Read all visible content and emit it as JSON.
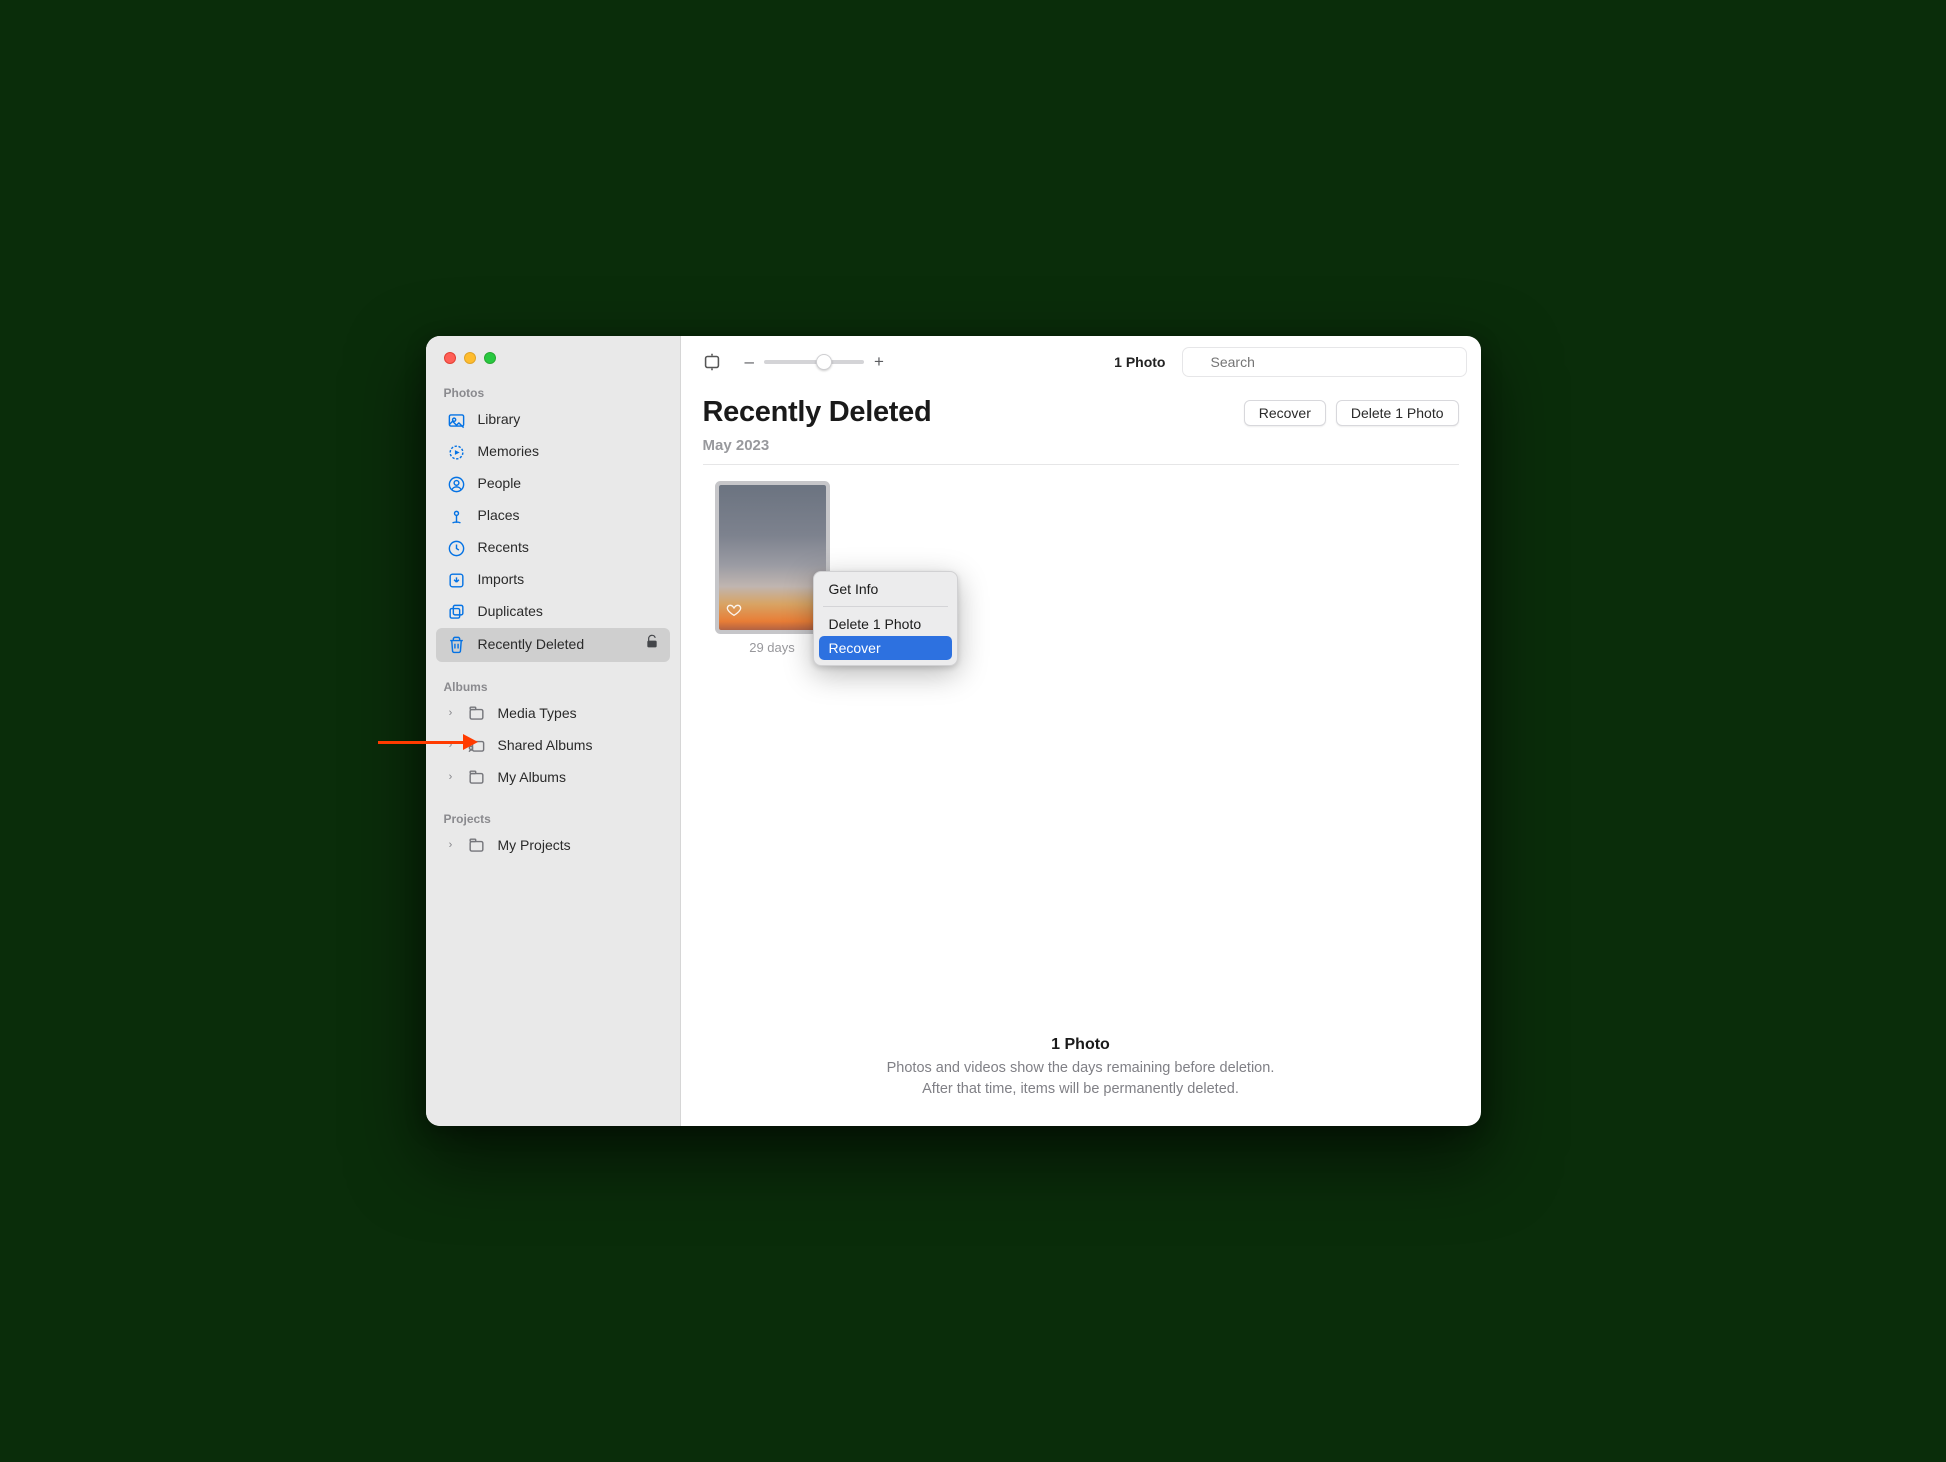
{
  "colors": {
    "accent": "#0472e4",
    "menu_highlight": "#2d71e0",
    "annotation_arrow": "#ff3b00"
  },
  "toolbar": {
    "photo_count": "1 Photo",
    "search_placeholder": "Search"
  },
  "sidebar": {
    "sections": {
      "photos": {
        "label": "Photos",
        "items": [
          {
            "id": "library",
            "label": "Library"
          },
          {
            "id": "memories",
            "label": "Memories"
          },
          {
            "id": "people",
            "label": "People"
          },
          {
            "id": "places",
            "label": "Places"
          },
          {
            "id": "recents",
            "label": "Recents"
          },
          {
            "id": "imports",
            "label": "Imports"
          },
          {
            "id": "duplicates",
            "label": "Duplicates"
          },
          {
            "id": "recently-deleted",
            "label": "Recently Deleted"
          }
        ]
      },
      "albums": {
        "label": "Albums",
        "items": [
          {
            "id": "media-types",
            "label": "Media Types"
          },
          {
            "id": "shared-albums",
            "label": "Shared Albums"
          },
          {
            "id": "my-albums",
            "label": "My Albums"
          }
        ]
      },
      "projects": {
        "label": "Projects",
        "items": [
          {
            "id": "my-projects",
            "label": "My Projects"
          }
        ]
      }
    }
  },
  "page": {
    "title": "Recently Deleted",
    "actions": {
      "recover": "Recover",
      "delete": "Delete 1 Photo"
    }
  },
  "month": {
    "label": "May 2023"
  },
  "thumbnail": {
    "days_left": "29 days"
  },
  "context_menu": {
    "get_info": "Get Info",
    "delete": "Delete 1 Photo",
    "recover": "Recover"
  },
  "footer": {
    "count": "1 Photo",
    "line1": "Photos and videos show the days remaining before deletion.",
    "line2": "After that time, items will be permanently deleted."
  }
}
